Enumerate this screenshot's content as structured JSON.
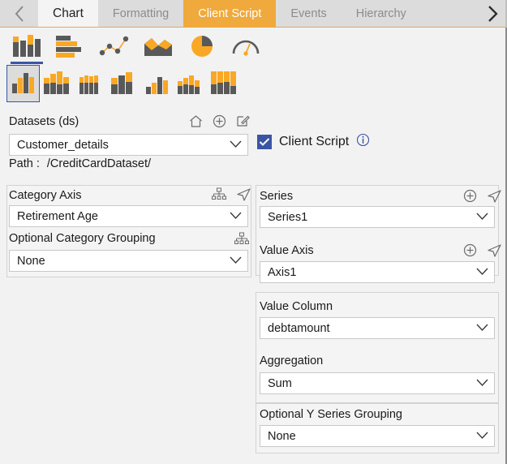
{
  "tabs": {
    "prev_icon": "chevron-left-icon",
    "next_icon": "chevron-right-icon",
    "items": [
      {
        "label": "Chart",
        "state": "active-light"
      },
      {
        "label": "Formatting",
        "state": "inactive"
      },
      {
        "label": "Client Script",
        "state": "active-orange"
      },
      {
        "label": "Events",
        "state": "inactive"
      },
      {
        "label": "Hierarchy",
        "state": "inactive"
      }
    ]
  },
  "ribbon": {
    "row1": [
      {
        "name": "column-chart-icon",
        "selected": true
      },
      {
        "name": "bar-chart-icon",
        "selected": false
      },
      {
        "name": "line-scatter-chart-icon",
        "selected": false
      },
      {
        "name": "area-chart-icon",
        "selected": false
      },
      {
        "name": "pie-chart-icon",
        "selected": false
      },
      {
        "name": "gauge-chart-icon",
        "selected": false
      }
    ],
    "row2": [
      {
        "name": "clustered-column-icon",
        "selected": true
      },
      {
        "name": "stacked-column-icon",
        "selected": false
      },
      {
        "name": "stacked-column-100-icon",
        "selected": false
      },
      {
        "name": "stacked-column-wide-icon",
        "selected": false
      },
      {
        "name": "clustered-column-small-icon",
        "selected": false
      },
      {
        "name": "clustered-stacked-column-icon",
        "selected": false
      },
      {
        "name": "full-stacked-column-icon",
        "selected": false
      }
    ]
  },
  "datasets": {
    "label": "Datasets (ds)",
    "icons": [
      {
        "name": "home-icon"
      },
      {
        "name": "add-circle-icon"
      },
      {
        "name": "edit-icon"
      }
    ],
    "selected": "Customer_details",
    "path_label": "Path :",
    "path_value": "/CreditCardDataset/"
  },
  "client_script": {
    "label": "Client Script",
    "checked": true,
    "check_glyph": "✓",
    "info_icon": "info-icon",
    "accent_color": "#3b55a4"
  },
  "category_axis": {
    "label": "Category Axis",
    "selected": "Retirement Age",
    "icons": [
      {
        "name": "hierarchy-icon"
      },
      {
        "name": "navigate-arrow-icon"
      }
    ]
  },
  "optional_category_grouping": {
    "label": "Optional Category Grouping",
    "selected": "None",
    "icons": [
      {
        "name": "hierarchy-icon"
      }
    ]
  },
  "series": {
    "label": "Series",
    "selected": "Series1",
    "icons": [
      {
        "name": "add-circle-icon"
      },
      {
        "name": "navigate-arrow-icon"
      }
    ]
  },
  "value_axis": {
    "label": "Value Axis",
    "selected": "Axis1",
    "icons": [
      {
        "name": "add-circle-icon"
      },
      {
        "name": "navigate-arrow-icon"
      }
    ]
  },
  "value_column": {
    "label": "Value Column",
    "selected": "debtamount"
  },
  "aggregation": {
    "label": "Aggregation",
    "selected": "Sum"
  },
  "optional_y_series_grouping": {
    "label": "Optional Y Series Grouping",
    "selected": "None"
  },
  "colors": {
    "accent_orange": "#f0a93c",
    "accent_blue": "#3b55a4",
    "icon_gray": "#595959",
    "tab_inactive_bg": "#dcdcdc",
    "panel_bg": "#f4f4f4"
  }
}
